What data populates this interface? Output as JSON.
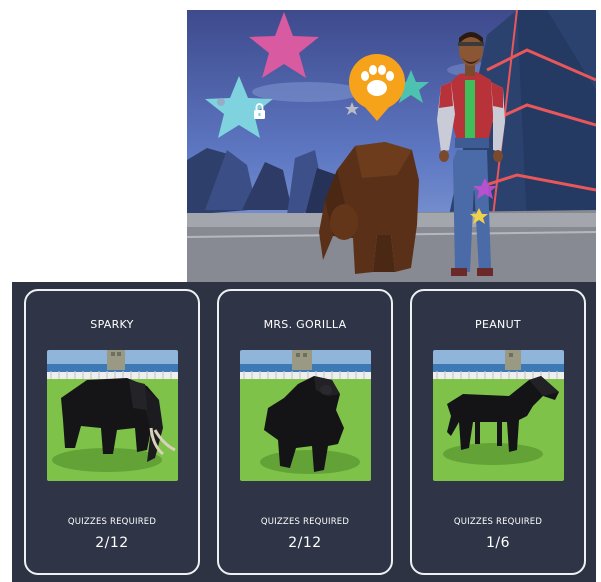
{
  "icons": {
    "map_marker": "paw-marker-icon",
    "locked_star": "lock-icon"
  },
  "colors": {
    "panel_bg": "#2d3342",
    "card_border": "#eef0f4",
    "marker_orange": "#f7a21b",
    "star_pink": "#d85aa0",
    "star_cyan": "#7fd3de",
    "star_teal": "#4ec2b0"
  },
  "animals": [
    {
      "name": "SPARKY",
      "animal": "elephant",
      "quizzes_label": "QUIZZES REQUIRED",
      "quizzes": "2/12"
    },
    {
      "name": "MRS. GORILLA",
      "animal": "gorilla",
      "quizzes_label": "QUIZZES REQUIRED",
      "quizzes": "2/12"
    },
    {
      "name": "PEANUT",
      "animal": "horse",
      "quizzes_label": "QUIZZES REQUIRED",
      "quizzes": "1/6"
    }
  ]
}
